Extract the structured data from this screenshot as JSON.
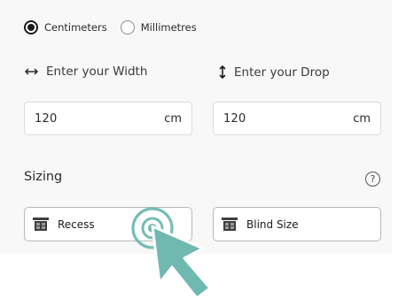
{
  "units": {
    "options": [
      {
        "label": "Centimeters",
        "selected": true
      },
      {
        "label": "Millimetres",
        "selected": false
      }
    ]
  },
  "dimensions": {
    "width": {
      "label": "Enter your Width",
      "value": "120",
      "unit": "cm",
      "icon": "horizontal-arrows-icon"
    },
    "drop": {
      "label": "Enter your Drop",
      "value": "120",
      "unit": "cm",
      "icon": "vertical-arrows-icon"
    }
  },
  "sizing": {
    "title": "Sizing",
    "help": "?",
    "options": [
      {
        "label": "Recess",
        "icon": "window-icon"
      },
      {
        "label": "Blind Size",
        "icon": "window-icon"
      }
    ]
  },
  "colors": {
    "background": "#ffffff",
    "panel": "#f8f8f8",
    "text": "#2b2b2b",
    "radio_selected": "#1c1c1c",
    "pointer_accent": "#6fb9b1"
  },
  "pointer": {
    "icon": "click-pointer-icon"
  }
}
